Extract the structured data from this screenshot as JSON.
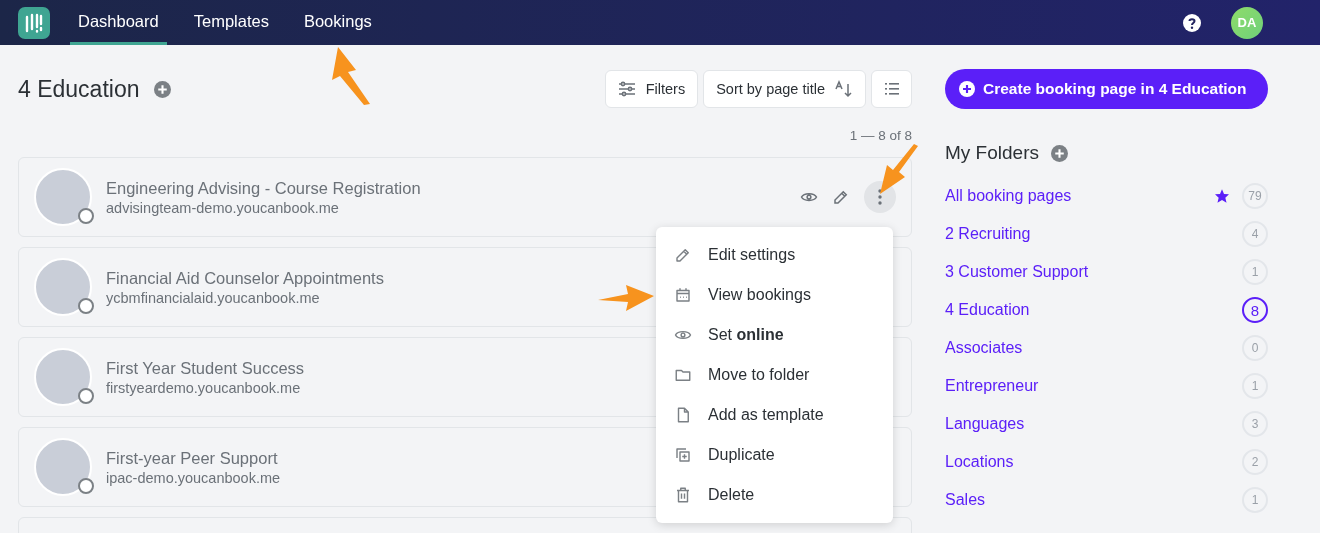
{
  "nav": {
    "tabs": [
      {
        "label": "Dashboard",
        "selected": true
      },
      {
        "label": "Templates",
        "selected": false
      },
      {
        "label": "Bookings",
        "selected": false
      }
    ],
    "avatar_initials": "DA"
  },
  "header": {
    "title": "4 Education",
    "filters_label": "Filters",
    "sort_label": "Sort by page title",
    "range": "1 — 8 of 8"
  },
  "booking_pages": [
    {
      "title": "Engineering Advising - Course Registration",
      "url": "advisingteam-demo.youcanbook.me",
      "hovered": true
    },
    {
      "title": "Financial Aid Counselor Appointments",
      "url": "ycbmfinancialaid.youcanbook.me",
      "hovered": false
    },
    {
      "title": "First Year Student Success",
      "url": "firstyeardemo.youcanbook.me",
      "hovered": false
    },
    {
      "title": "First-year Peer Support",
      "url": "ipac-demo.youcanbook.me",
      "hovered": false
    }
  ],
  "menu": {
    "items": [
      {
        "kind": "edit",
        "label": "Edit settings"
      },
      {
        "kind": "calendar",
        "label": "View bookings"
      },
      {
        "kind": "eye",
        "label": "Set **online**"
      },
      {
        "kind": "folder",
        "label": "Move to folder"
      },
      {
        "kind": "file",
        "label": "Add as template"
      },
      {
        "kind": "copy",
        "label": "Duplicate"
      },
      {
        "kind": "trash",
        "label": "Delete"
      }
    ]
  },
  "create_button": "Create booking page in 4 Education",
  "folders": {
    "title": "My Folders",
    "items": [
      {
        "name": "All booking pages",
        "count": "79",
        "starred": true,
        "selected": false
      },
      {
        "name": "2 Recruiting",
        "count": "4",
        "starred": false,
        "selected": false
      },
      {
        "name": "3 Customer Support",
        "count": "1",
        "starred": false,
        "selected": false
      },
      {
        "name": "4 Education",
        "count": "8",
        "starred": false,
        "selected": true
      },
      {
        "name": "Associates",
        "count": "0",
        "starred": false,
        "selected": false
      },
      {
        "name": "Entrepreneur",
        "count": "1",
        "starred": false,
        "selected": false
      },
      {
        "name": "Languages",
        "count": "3",
        "starred": false,
        "selected": false
      },
      {
        "name": "Locations",
        "count": "2",
        "starred": false,
        "selected": false
      },
      {
        "name": "Sales",
        "count": "1",
        "starred": false,
        "selected": false
      }
    ]
  }
}
